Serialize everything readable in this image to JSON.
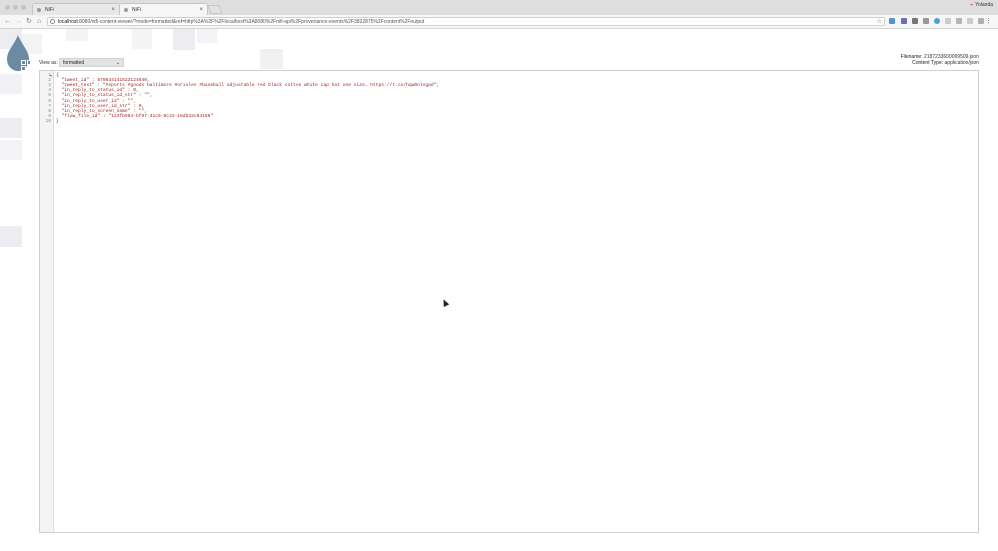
{
  "browser": {
    "tabs": [
      {
        "title": "NiFi"
      },
      {
        "title": "NiFi"
      }
    ],
    "user": "Yolanda",
    "url_host": "localhost",
    "url_rest": ":8080/nifi-content-viewer/?mode=formatted&ref=http%3A%2F%2Flocalhost%3A8080%2Fnifi-api%2Fprovenance-events%2F3822875%2Fcontent%2Foutput"
  },
  "viewer": {
    "view_as_label": "View as:",
    "view_as_value": "formatted",
    "filename_label": "Filename:",
    "filename_value": "2187233600099509.json",
    "content_type_label": "Content Type:",
    "content_type_value": "application/json"
  },
  "code": {
    "line_numbers": [
      "1",
      "2",
      "3",
      "4",
      "5",
      "6",
      "7",
      "8",
      "9",
      "10"
    ],
    "lines": [
      "{",
      "  \"tweet_id\" : 870634141523124940,",
      "  \"tweet_text\" : \"#sports #goods baltimore #orioles #baseball adjustable red black cotton white cap hat one size… https://t.co/hqwDnlvgad\",",
      "  \"in_reply_to_status_id\" : 0,",
      "  \"in_reply_to_status_id_str\" : \"\",",
      "  \"in_reply_to_user_id\" : \"\",",
      "  \"in_reply_to_user_id_str\" : 0,",
      "  \"in_reply_to_screen_name\" : \"\",",
      "  \"flow_file_id\" : \"123fb994-bf97-41c6-8c31-16db32c84169\"",
      "}"
    ]
  },
  "icons": {
    "logo": "nifi-drop-logo",
    "back": "back-arrow-icon",
    "forward": "forward-arrow-icon",
    "reload": "reload-icon",
    "home": "home-icon",
    "star": "star-icon"
  }
}
